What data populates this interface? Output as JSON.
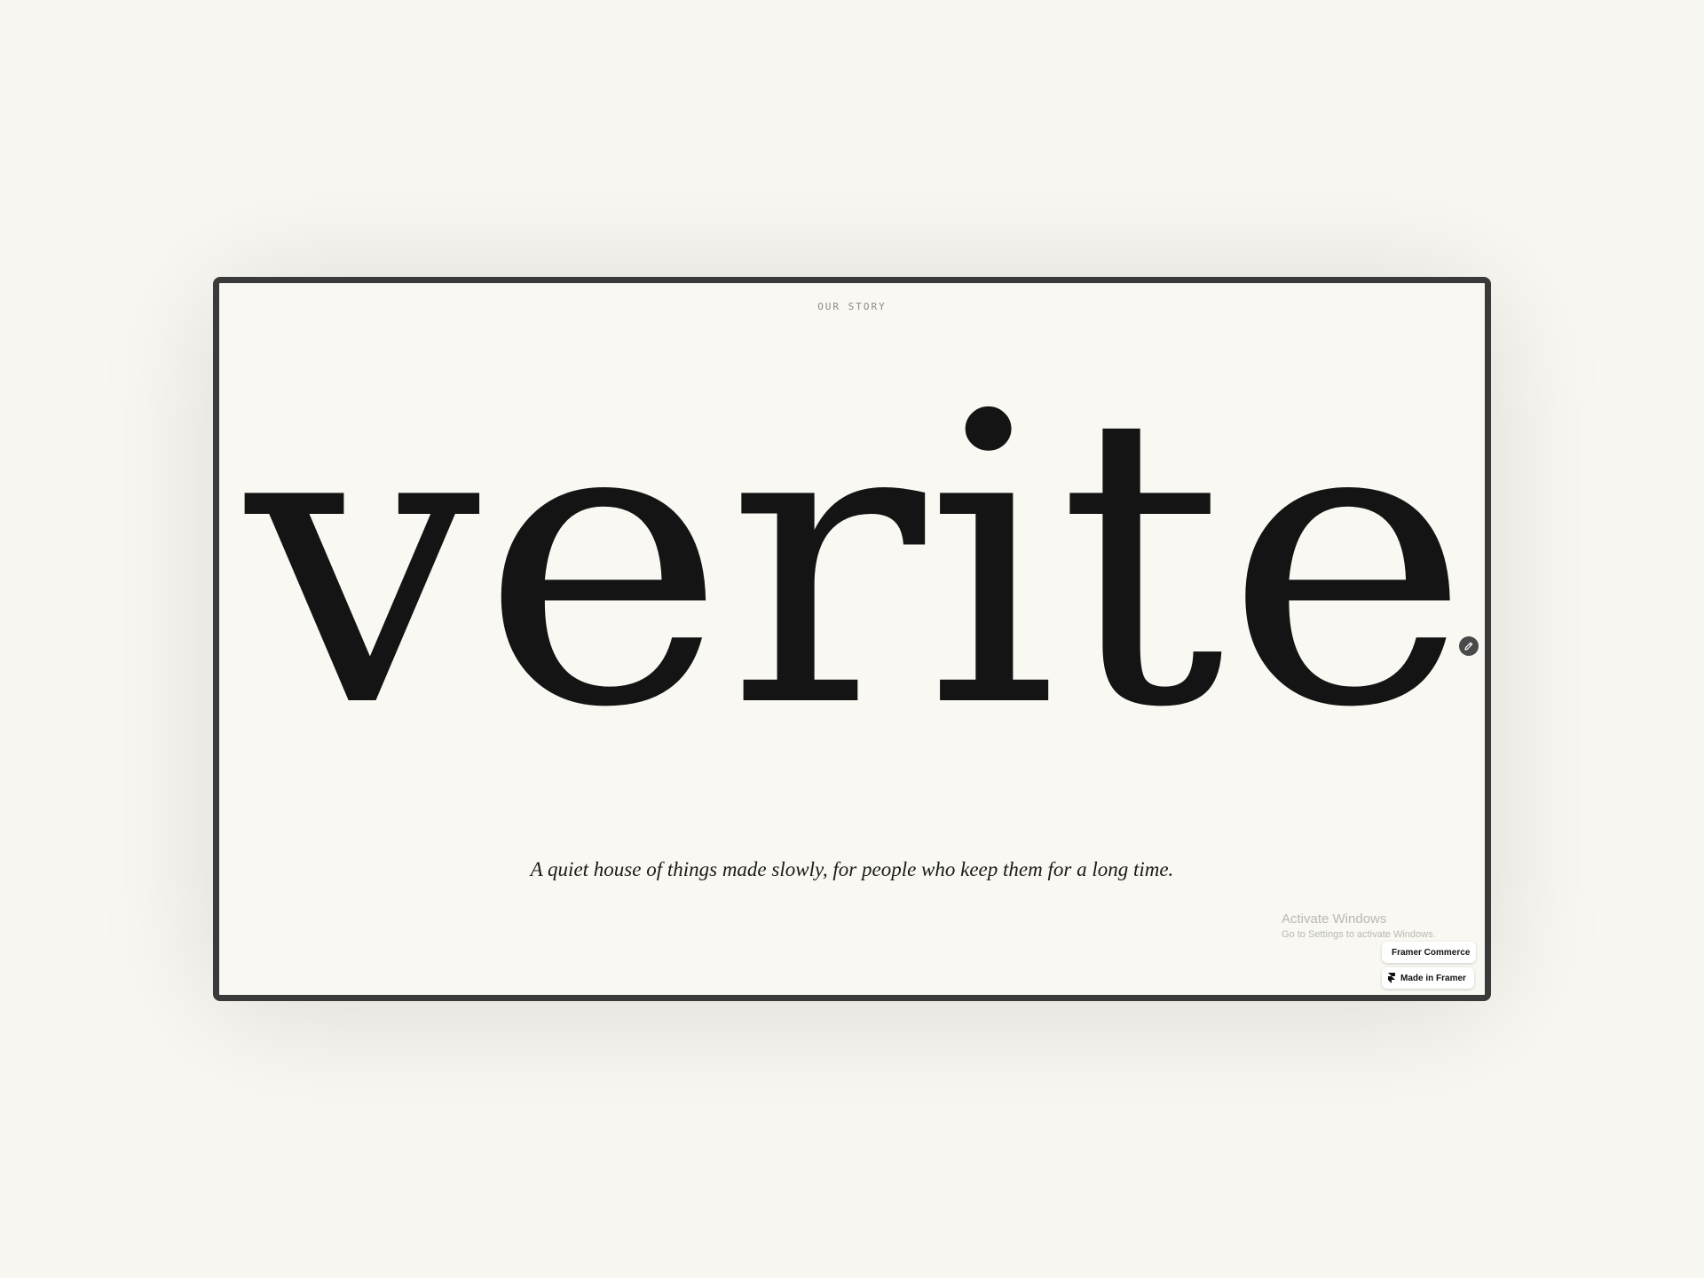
{
  "colors": {
    "page_background": "#f8f7f2",
    "frame_border": "#3a3a3a",
    "frame_background": "#f9f8f3",
    "ink": "#141414",
    "muted": "#8a8a86",
    "watermark": "#b9b9b4"
  },
  "hero": {
    "eyebrow": "OUR STORY",
    "wordmark": "verite",
    "tagline": "A quiet house of things made slowly, for people who keep them for a long time."
  },
  "os_watermark": {
    "title": "Activate Windows",
    "subtitle": "Go to Settings to activate Windows."
  },
  "badges": {
    "commerce": {
      "label": "Framer Commerce",
      "icon": "framer-commerce-icon"
    },
    "framer": {
      "label": "Made in Framer",
      "icon": "framer-logo-icon"
    }
  },
  "edit_button": {
    "icon": "pencil-icon"
  }
}
